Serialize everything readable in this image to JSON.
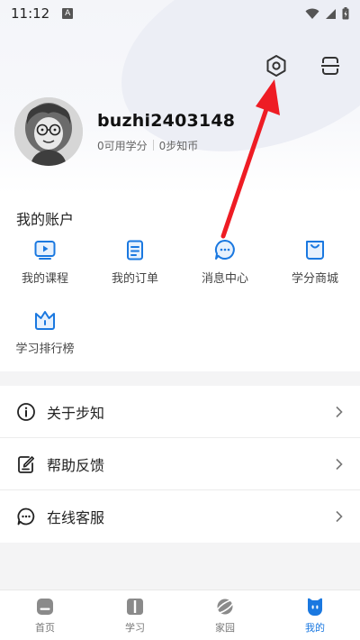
{
  "status_bar": {
    "time": "11:12",
    "notification_glyph": "A"
  },
  "profile": {
    "username": "buzhi2403148",
    "credits": "0可用学分",
    "coins": "0步知币"
  },
  "account": {
    "title": "我的账户",
    "items": [
      {
        "label": "我的课程",
        "icon": "video-icon"
      },
      {
        "label": "我的订单",
        "icon": "order-icon"
      },
      {
        "label": "消息中心",
        "icon": "message-icon"
      },
      {
        "label": "学分商城",
        "icon": "shop-bag-icon"
      },
      {
        "label": "学习排行榜",
        "icon": "crown-icon"
      }
    ]
  },
  "menu": [
    {
      "label": "关于步知",
      "icon": "info-icon"
    },
    {
      "label": "帮助反馈",
      "icon": "feedback-icon"
    },
    {
      "label": "在线客服",
      "icon": "chat-icon"
    }
  ],
  "tabs": [
    {
      "label": "首页",
      "icon": "home-icon",
      "active": false
    },
    {
      "label": "学习",
      "icon": "book-icon",
      "active": false
    },
    {
      "label": "家园",
      "icon": "planet-icon",
      "active": false
    },
    {
      "label": "我的",
      "icon": "profile-face-icon",
      "active": true
    }
  ],
  "colors": {
    "accent": "#1a78e0",
    "annotation_arrow": "#ee1c24"
  }
}
